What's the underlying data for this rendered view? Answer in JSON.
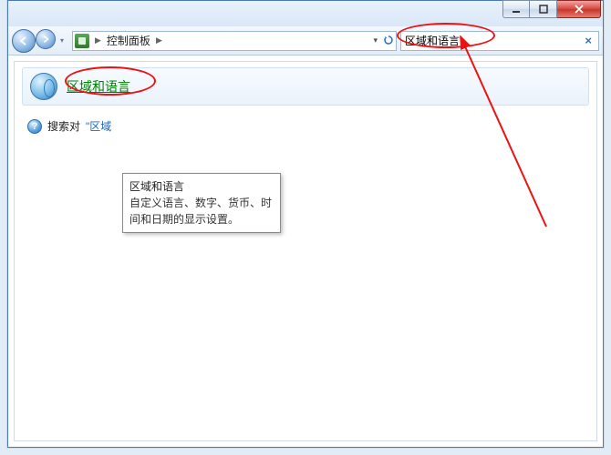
{
  "window": {
    "minimize_tip": "Minimize",
    "maximize_tip": "Maximize",
    "close_tip": "Close"
  },
  "nav": {
    "back_tip": "Back",
    "forward_tip": "Forward"
  },
  "address": {
    "location": "控制面板",
    "sep": "▶",
    "dropdown_tip": "History",
    "refresh_tip": "Refresh"
  },
  "search": {
    "query": "区域和语言",
    "clear_tip": "Clear"
  },
  "result": {
    "link_label": "区域和语言"
  },
  "subline": {
    "prefix": "搜索对",
    "quoted_fragment": "\"区域"
  },
  "tooltip": {
    "title": "区域和语言",
    "body": "自定义语言、数字、货币、时间和日期的显示设置。"
  }
}
